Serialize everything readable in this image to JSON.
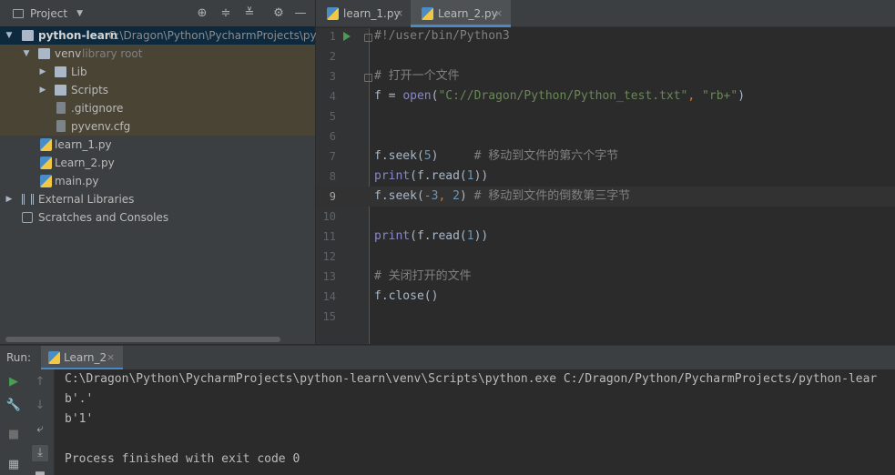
{
  "project_panel": {
    "title": "Project",
    "tree": [
      {
        "label": "python-learn",
        "path": "C:\\Dragon\\Python\\PycharmProjects\\pytho"
      },
      {
        "label": "venv",
        "note": "library root"
      },
      {
        "label": "Lib"
      },
      {
        "label": "Scripts"
      },
      {
        "label": ".gitignore"
      },
      {
        "label": "pyvenv.cfg"
      },
      {
        "label": "learn_1.py"
      },
      {
        "label": "Learn_2.py"
      },
      {
        "label": "main.py"
      },
      {
        "label": "External Libraries"
      },
      {
        "label": "Scratches and Consoles"
      }
    ]
  },
  "tabs": [
    {
      "label": "learn_1.py",
      "active": false
    },
    {
      "label": "Learn_2.py",
      "active": true
    }
  ],
  "editor": {
    "current_line": "9",
    "line_numbers": [
      "1",
      "2",
      "3",
      "4",
      "5",
      "6",
      "7",
      "8",
      "9",
      "10",
      "11",
      "12",
      "13",
      "14",
      "15"
    ],
    "lines": {
      "l1": "#!/user/bin/Python3",
      "l3": "# 打开一个文件",
      "l4_a": "f = ",
      "l4_b": "open",
      "l4_c": "(",
      "l4_d": "\"C://Dragon/Python/Python_test.txt\"",
      "l4_e": ", ",
      "l4_f": "\"rb+\"",
      "l4_g": ")",
      "l7_a": "f.seek(",
      "l7_b": "5",
      "l7_c": ")     ",
      "l7_d": "# 移动到文件的第六个字节",
      "l8_a": "print",
      "l8_b": "(f.read(",
      "l8_c": "1",
      "l8_d": "))",
      "l9_a": "f.seek(",
      "l9_b": "-3",
      "l9_c": ", ",
      "l9_d": "2",
      "l9_e": ") ",
      "l9_f": "# 移动到文件的倒数第三字节",
      "l11_a": "print",
      "l11_b": "(f.read(",
      "l11_c": "1",
      "l11_d": "))",
      "l13": "# 关闭打开的文件",
      "l14": "f.close()"
    }
  },
  "run_panel": {
    "label": "Run:",
    "tab": "Learn_2",
    "output": [
      "C:\\Dragon\\Python\\PycharmProjects\\python-learn\\venv\\Scripts\\python.exe C:/Dragon/Python/PycharmProjects/python-lear",
      "b'.'",
      "b'1'",
      "",
      "Process finished with exit code 0"
    ]
  },
  "colors": {
    "accent": "#4a88c7",
    "run_green": "#499c54",
    "string": "#6a8759",
    "number": "#6897bb",
    "comment": "#808080"
  }
}
